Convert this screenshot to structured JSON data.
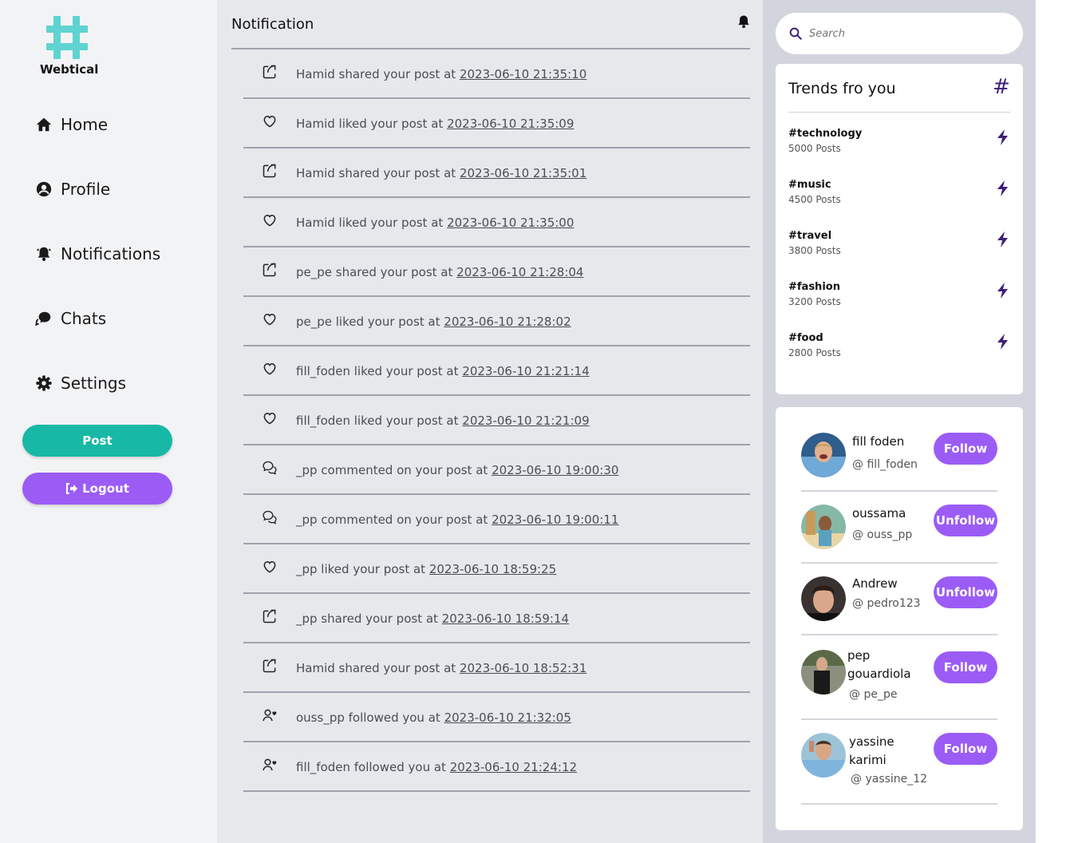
{
  "brand": {
    "name": "Webtical",
    "logo_color": "#5fd3d0"
  },
  "nav": [
    {
      "label": "Home",
      "icon": "home-icon"
    },
    {
      "label": "Profile",
      "icon": "user-circle-icon"
    },
    {
      "label": "Notifications",
      "icon": "bell-icon"
    },
    {
      "label": "Chats",
      "icon": "chat-icon"
    },
    {
      "label": "Settings",
      "icon": "gear-icon"
    }
  ],
  "buttons": {
    "post_label": "Post",
    "logout_label": "Logout",
    "post_color": "#17b8a6",
    "accent_color": "#9b5cf6"
  },
  "notifications": {
    "title": "Notification",
    "items": [
      {
        "type": "share",
        "text": "Hamid shared your post at",
        "time": "2023-06-10 21:35:10"
      },
      {
        "type": "like",
        "text": "Hamid liked your post at",
        "time": "2023-06-10 21:35:09"
      },
      {
        "type": "share",
        "text": "Hamid shared your post at",
        "time": "2023-06-10 21:35:01"
      },
      {
        "type": "like",
        "text": "Hamid liked your post at",
        "time": "2023-06-10 21:35:00"
      },
      {
        "type": "share",
        "text": "pe_pe shared your post at",
        "time": "2023-06-10 21:28:04"
      },
      {
        "type": "like",
        "text": "pe_pe liked your post at",
        "time": "2023-06-10 21:28:02"
      },
      {
        "type": "like",
        "text": "fill_foden liked your post at",
        "time": "2023-06-10 21:21:14"
      },
      {
        "type": "like",
        "text": "fill_foden liked your post at",
        "time": "2023-06-10 21:21:09"
      },
      {
        "type": "comment",
        "text": "_pp commented on your post at",
        "time": "2023-06-10 19:00:30"
      },
      {
        "type": "comment",
        "text": "_pp commented on your post at",
        "time": "2023-06-10 19:00:11"
      },
      {
        "type": "like",
        "text": "_pp liked your post at",
        "time": "2023-06-10 18:59:25"
      },
      {
        "type": "share",
        "text": "_pp shared your post at",
        "time": "2023-06-10 18:59:14"
      },
      {
        "type": "share",
        "text": "Hamid shared your post at",
        "time": "2023-06-10 18:52:31"
      },
      {
        "type": "follow",
        "text": "ouss_pp followed you at",
        "time": "2023-06-10 21:32:05"
      },
      {
        "type": "follow",
        "text": "fill_foden followed you at",
        "time": "2023-06-10 21:24:12"
      }
    ]
  },
  "search": {
    "placeholder": "Search"
  },
  "trends": {
    "title": "Trends fro you",
    "hash": "#",
    "items": [
      {
        "tag": "#technology",
        "count": "5000 Posts"
      },
      {
        "tag": "#music",
        "count": "4500 Posts"
      },
      {
        "tag": "#travel",
        "count": "3800 Posts"
      },
      {
        "tag": "#fashion",
        "count": "3200 Posts"
      },
      {
        "tag": "#food",
        "count": "2800 Posts"
      }
    ]
  },
  "suggestions": [
    {
      "name": "fill foden",
      "handle": "@ fill_foden",
      "action": "Follow"
    },
    {
      "name": "oussama",
      "handle": "@ ouss_pp",
      "action": "Unfollow"
    },
    {
      "name": "Andrew",
      "handle": "@ pedro123",
      "action": "Unfollow"
    },
    {
      "name": "pep gouardiola",
      "handle": "@ pe_pe",
      "action": "Follow"
    },
    {
      "name": "yassine karimi",
      "handle": "@ yassine_12",
      "action": "Follow"
    }
  ]
}
